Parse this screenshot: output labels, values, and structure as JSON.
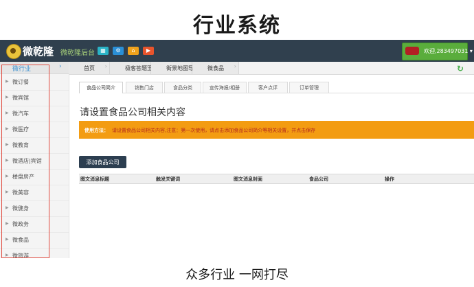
{
  "hero": {
    "title": "行业系统",
    "caption": "众多行业 一网打尽"
  },
  "app": {
    "logo_text": "微乾隆",
    "subtitle": "微乾隆后台",
    "user_label": "欢迎,283497031 ▾"
  },
  "toolbar_icons": [
    {
      "name": "grid-icon",
      "glyph": "▦",
      "color": "#2ab3c6"
    },
    {
      "name": "gear-icon",
      "glyph": "⚙",
      "color": "#2a8fd6"
    },
    {
      "name": "home-icon",
      "glyph": "⌂",
      "color": "#f0a21c"
    },
    {
      "name": "play-icon",
      "glyph": "▶",
      "color": "#e8542c"
    }
  ],
  "sidebar": {
    "header": "微行业",
    "items": [
      "微订餐",
      "微宾馆",
      "微汽车",
      "微医疗",
      "微教育",
      "微酒店|宾馆",
      "楼盘房产",
      "微美容",
      "微健身",
      "微政务",
      "微食品",
      "微旅游",
      "微花店",
      "微物业"
    ]
  },
  "page_tabs": [
    "首页",
    "极客答题王",
    "街景地图导航",
    "微食品"
  ],
  "sub_tabs": [
    "食品公司简介",
    "销售门店",
    "食品分类",
    "宣传海报/相册",
    "客户点评",
    "订单管理"
  ],
  "section_title": "请设置食品公司相关内容",
  "notice": {
    "label": "使用方法：",
    "text": "请设置食品公司相关内容,注意：第一次使用，请点击添加食品公司简介等相关设置，并点击保存"
  },
  "add_button": "添加食品公司",
  "table_headers": [
    "图文消息标题",
    "触发关键词",
    "图文消息封面",
    "食品公司",
    "操作"
  ],
  "colors": {
    "topbar": "#30404e",
    "accent_green": "#5aad3c",
    "notice_orange": "#f39c12",
    "button_dark": "#2c3e50",
    "highlight_red": "#e0473b"
  }
}
